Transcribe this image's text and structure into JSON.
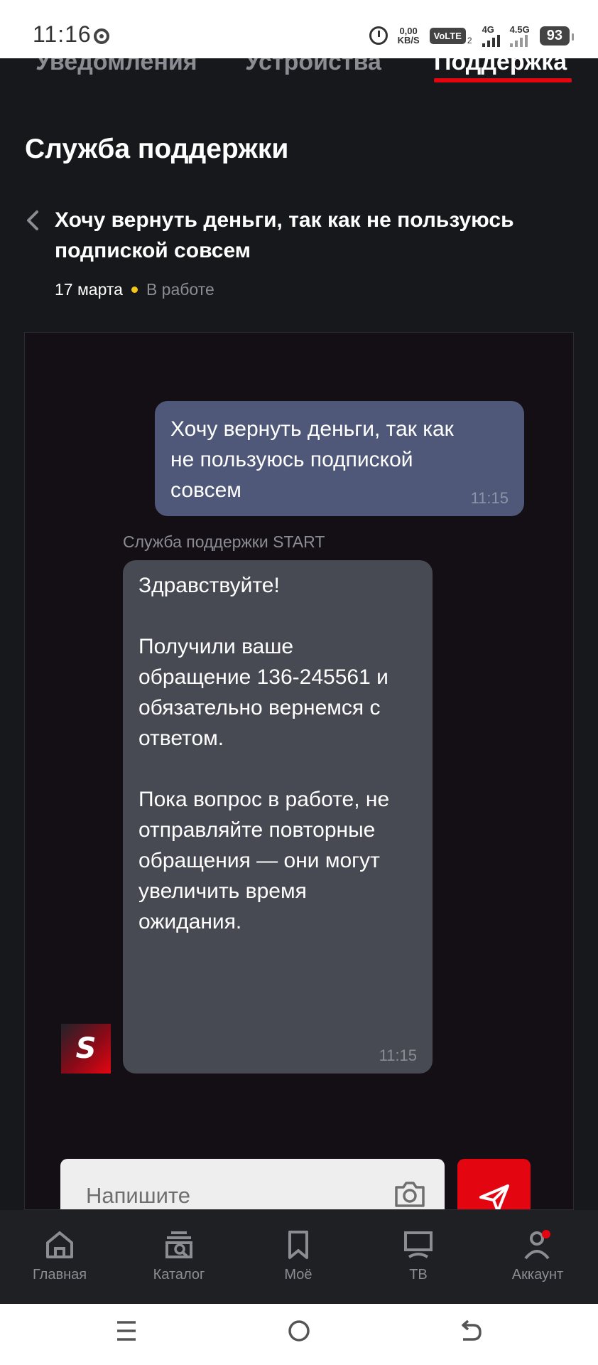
{
  "status_bar": {
    "time": "11:16",
    "speed_top": "0,00",
    "speed_bottom": "KB/S",
    "volte": "VoLTE",
    "sim2": "2",
    "net1": "4G",
    "net2": "4.5G",
    "battery": "93"
  },
  "tabs": [
    {
      "label": "Уведомления",
      "active": false
    },
    {
      "label": "Устройства",
      "active": false
    },
    {
      "label": "Поддержка",
      "active": true
    }
  ],
  "page_title": "Служба поддержки",
  "ticket": {
    "title": "Хочу вернуть деньги, так как не пользуюсь подпиской совсем",
    "date": "17 марта",
    "status": "В работе"
  },
  "messages": {
    "user": {
      "text": "Хочу вернуть деньги, так как не пользуюсь подпиской совсем",
      "time": "11:15"
    },
    "support": {
      "sender": "Служба поддержки START",
      "paragraphs": [
        "Здравствуйте!",
        "Получили ваше обращение 136-245561 и обязательно вернемся с ответом.",
        "Пока вопрос в работе, не отправляйте повторные обращения — они могут увеличить время ожидания."
      ],
      "time": "11:15",
      "avatar_letter": "S"
    }
  },
  "composer": {
    "placeholder": "Напишите"
  },
  "bottom_nav": [
    {
      "label": "Главная",
      "icon": "home-icon"
    },
    {
      "label": "Каталог",
      "icon": "catalog-icon"
    },
    {
      "label": "Моё",
      "icon": "bookmark-icon"
    },
    {
      "label": "ТВ",
      "icon": "tv-icon"
    },
    {
      "label": "Аккаунт",
      "icon": "account-icon"
    }
  ],
  "colors": {
    "accent": "#e30611",
    "background": "#17181c",
    "chat_bg": "#140f15",
    "user_bubble": "#4f5878",
    "support_bubble": "#474a52",
    "status_dot": "#f5c518"
  }
}
